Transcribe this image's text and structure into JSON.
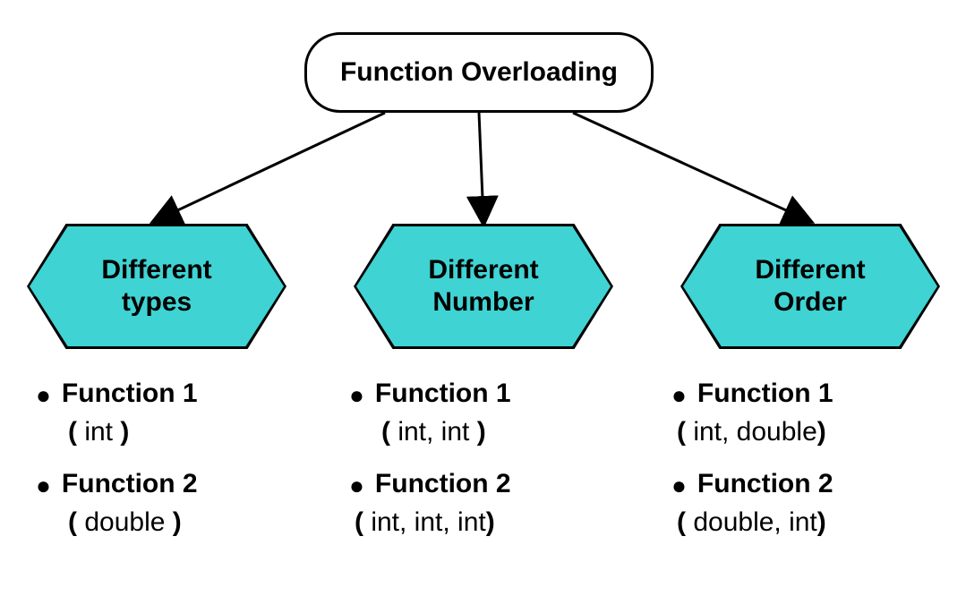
{
  "root": {
    "title": "Function Overloading"
  },
  "branches": [
    {
      "label_line1": "Different",
      "label_line2": "types",
      "items": [
        {
          "fname": "Function 1",
          "sig_parts": {
            "open": "( ",
            "types": "int",
            "close": " )"
          },
          "indent": true
        },
        {
          "fname": "Function 2",
          "sig_parts": {
            "open": "( ",
            "types": "double",
            "close": " )"
          },
          "indent": true
        }
      ]
    },
    {
      "label_line1": "Different",
      "label_line2": "Number",
      "items": [
        {
          "fname": "Function 1",
          "sig_parts": {
            "open": "( ",
            "types": "int, int",
            "close": " )"
          },
          "indent": true
        },
        {
          "fname": "Function 2",
          "sig_parts": {
            "open": "( ",
            "types": "int, int,  int",
            "close": ")"
          },
          "indent": false
        }
      ]
    },
    {
      "label_line1": "Different",
      "label_line2": "Order",
      "items": [
        {
          "fname": "Function 1",
          "sig_parts": {
            "open": "( ",
            "types": "int, double",
            "close": ")"
          },
          "indent": false
        },
        {
          "fname": "Function 2",
          "sig_parts": {
            "open": "( ",
            "types": "double, int",
            "close": ")"
          },
          "indent": false
        }
      ]
    }
  ],
  "colors": {
    "hex_fill": "#3fd3d3",
    "stroke": "#000000"
  }
}
